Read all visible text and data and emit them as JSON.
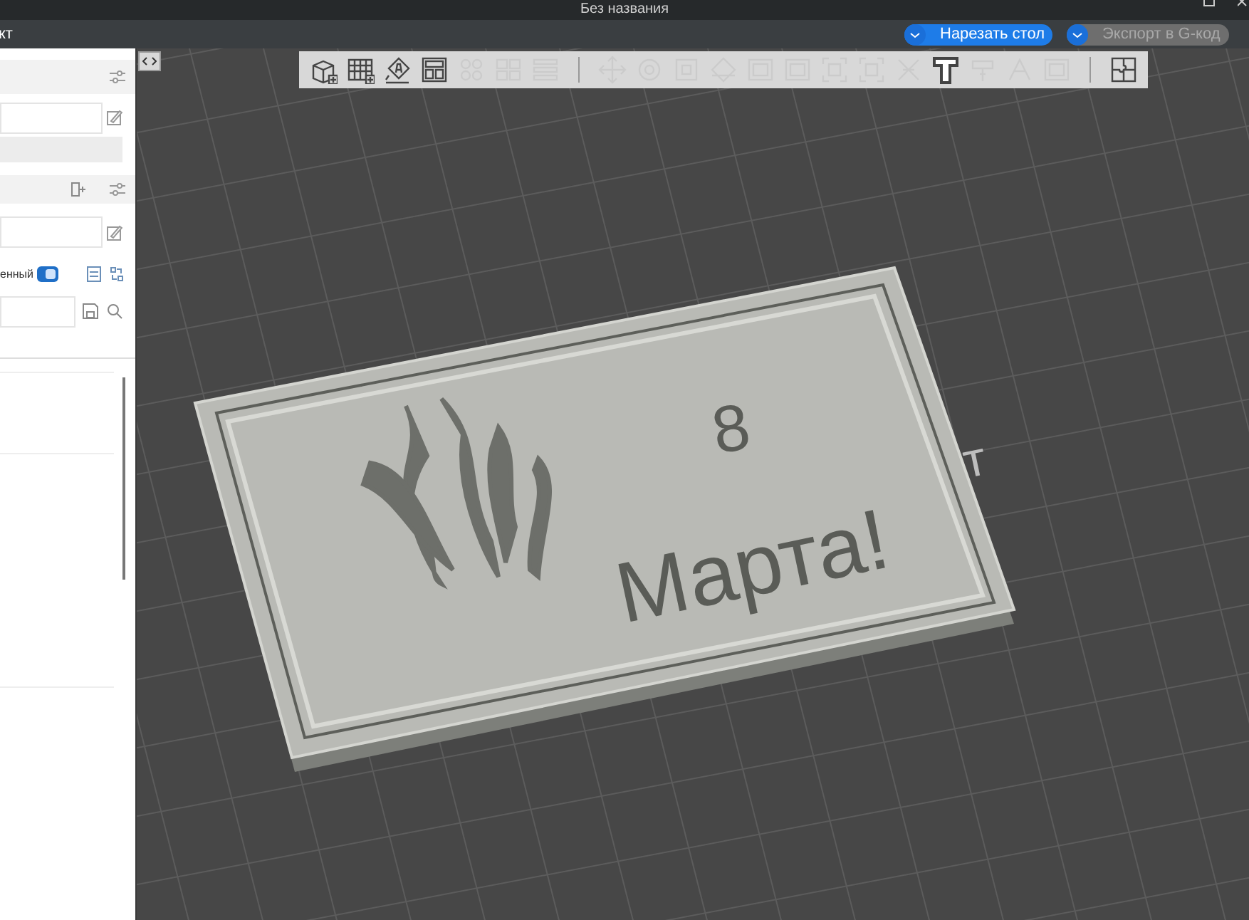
{
  "window": {
    "title": "Без названия"
  },
  "menu_bar": {
    "tab_label": "кт",
    "slice_button": {
      "label": "Нарезать стол",
      "disabled": false
    },
    "export_button": {
      "label": "Экспорт в G-код",
      "disabled": true
    }
  },
  "left_panel": {
    "toggle_label": "енный",
    "toggle_on": true
  },
  "toolbar": {
    "tools": [
      {
        "kind": "cube",
        "disabled": false
      },
      {
        "kind": "grid",
        "disabled": false
      },
      {
        "kind": "text-a",
        "disabled": false
      },
      {
        "kind": "layout",
        "disabled": false
      },
      {
        "kind": "dots",
        "disabled": true
      },
      {
        "kind": "squares",
        "disabled": true
      },
      {
        "kind": "lines",
        "disabled": true
      },
      {
        "kind": "separator"
      },
      {
        "kind": "move",
        "disabled": true
      },
      {
        "kind": "rotate",
        "disabled": true
      },
      {
        "kind": "scale",
        "disabled": true
      },
      {
        "kind": "cut",
        "disabled": true
      },
      {
        "kind": "box",
        "disabled": true
      },
      {
        "kind": "box",
        "disabled": true
      },
      {
        "kind": "brackets",
        "disabled": true
      },
      {
        "kind": "brackets",
        "disabled": true
      },
      {
        "kind": "support",
        "disabled": true
      },
      {
        "kind": "text-t",
        "disabled": false
      },
      {
        "kind": "paint",
        "disabled": true
      },
      {
        "kind": "seam",
        "disabled": true
      },
      {
        "kind": "box",
        "disabled": true
      },
      {
        "kind": "separator"
      },
      {
        "kind": "puzzle",
        "disabled": false
      }
    ]
  },
  "model": {
    "line_1": "8",
    "line_2": "Марта!"
  },
  "bed_label": "т"
}
